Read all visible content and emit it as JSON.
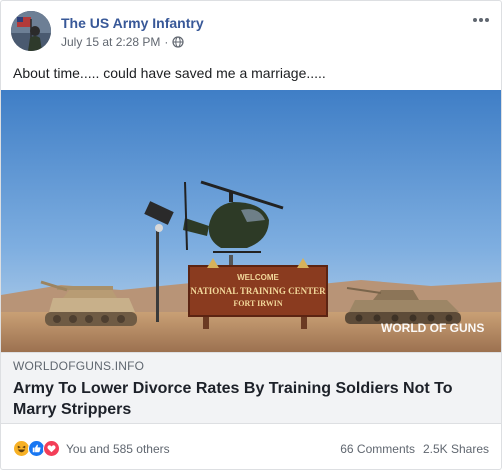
{
  "post": {
    "page_name": "The US Army Infantry",
    "timestamp": "July 15 at 2:28 PM",
    "separator": "·",
    "privacy_icon": "globe-icon",
    "more_icon": "more-options-icon",
    "message": "About time..... could have saved me a marriage....."
  },
  "link_card": {
    "image": {
      "sign_top": "WELCOME",
      "sign_main": "NATIONAL TRAINING CENTER",
      "sign_sub": "FORT IRWIN",
      "watermark": "WORLD OF GUNS"
    },
    "domain": "WORLDOFGUNS.INFO",
    "headline": "Army To Lower Divorce Rates By Training Soldiers Not To Marry Strippers"
  },
  "footer": {
    "reaction_icons": [
      "haha-icon",
      "like-icon",
      "love-icon"
    ],
    "reaction_text": "You and 585 others",
    "comments": "66 Comments",
    "shares": "2.5K Shares"
  },
  "colors": {
    "page_name": "#385898",
    "meta": "#616770",
    "card_bg": "#f2f3f5",
    "like_blue": "#1877f2",
    "love_red": "#f33e58",
    "haha_yellow": "#f7b125"
  }
}
